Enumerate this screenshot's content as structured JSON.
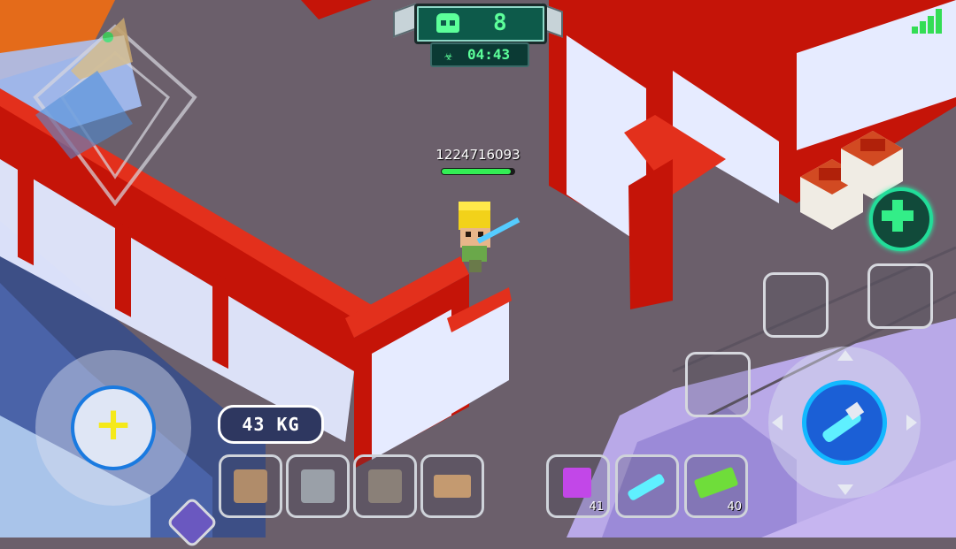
{
  "match": {
    "players_alive": "8",
    "timer": "04:43"
  },
  "player": {
    "id_label": "1224716093",
    "health_fraction": 0.95
  },
  "inventory": {
    "weight": "43 KG",
    "resources": [
      "cardboard-block",
      "stone-block",
      "metal-block",
      "wood-planks"
    ],
    "weapons": [
      {
        "name": "purple-blaster",
        "count": "41"
      },
      {
        "name": "cyan-laser-sword",
        "count": ""
      },
      {
        "name": "green-launcher",
        "count": "40"
      }
    ]
  },
  "controls": {
    "build_symbol": "+",
    "heal_symbol": "+"
  },
  "colors": {
    "wall_red": "#d7190b",
    "floor": "#6b5f6b",
    "accent_green": "#33ee55",
    "accent_cyan": "#1ad0ff"
  }
}
